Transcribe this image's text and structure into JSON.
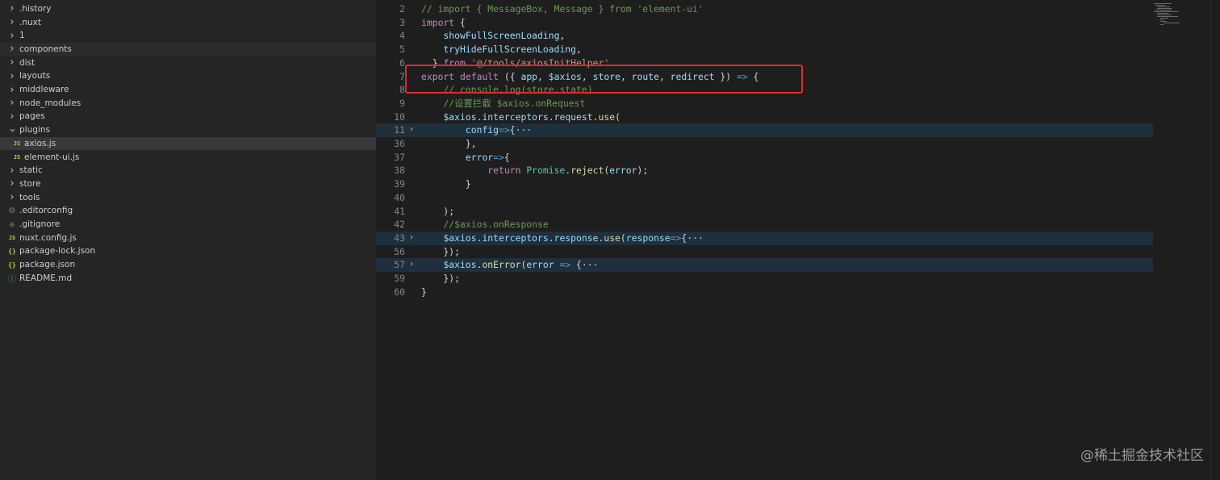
{
  "explorer": {
    "items": [
      {
        "label": ".history",
        "kind": "folder",
        "icon": "chevron-right-icon"
      },
      {
        "label": ".nuxt",
        "kind": "folder",
        "icon": "chevron-right-icon"
      },
      {
        "label": "1",
        "kind": "folder",
        "icon": "chevron-right-icon"
      },
      {
        "label": "components",
        "kind": "folder",
        "icon": "chevron-right-icon"
      },
      {
        "label": "dist",
        "kind": "folder",
        "icon": "chevron-right-icon"
      },
      {
        "label": "layouts",
        "kind": "folder",
        "icon": "chevron-right-icon"
      },
      {
        "label": "middleware",
        "kind": "folder",
        "icon": "chevron-right-icon"
      },
      {
        "label": "node_modules",
        "kind": "folder",
        "icon": "chevron-right-icon"
      },
      {
        "label": "pages",
        "kind": "folder",
        "icon": "chevron-right-icon"
      },
      {
        "label": "plugins",
        "kind": "folder-open",
        "icon": "chevron-down-icon"
      },
      {
        "label": "axios.js",
        "kind": "js",
        "icon": "js-file-icon",
        "badge": "JS",
        "nested": true,
        "selected": true
      },
      {
        "label": "element-ui.js",
        "kind": "js",
        "icon": "js-file-icon",
        "badge": "JS",
        "nested": true
      },
      {
        "label": "static",
        "kind": "folder",
        "icon": "chevron-right-icon"
      },
      {
        "label": "store",
        "kind": "folder",
        "icon": "chevron-right-icon"
      },
      {
        "label": "tools",
        "kind": "folder",
        "icon": "chevron-right-icon"
      },
      {
        "label": ".editorconfig",
        "kind": "config",
        "icon": "gear-icon"
      },
      {
        "label": ".gitignore",
        "kind": "git",
        "icon": "git-icon"
      },
      {
        "label": "nuxt.config.js",
        "kind": "js",
        "icon": "js-file-icon",
        "badge": "JS"
      },
      {
        "label": "package-lock.json",
        "kind": "json",
        "icon": "json-file-icon",
        "badge": "{}"
      },
      {
        "label": "package.json",
        "kind": "json",
        "icon": "json-file-icon",
        "badge": "{}"
      },
      {
        "label": "README.md",
        "kind": "md",
        "icon": "info-icon"
      }
    ]
  },
  "editor": {
    "lines": [
      {
        "n": "2",
        "fold": "",
        "bg": false,
        "tokens": [
          [
            "tok-comment",
            "// import { MessageBox, Message } from 'element-ui'"
          ]
        ]
      },
      {
        "n": "3",
        "fold": "",
        "bg": false,
        "tokens": [
          [
            "tok-kw",
            "import"
          ],
          [
            "tok-punc",
            " {"
          ]
        ]
      },
      {
        "n": "4",
        "fold": "",
        "bg": false,
        "tokens": [
          [
            "tok-punc",
            "    "
          ],
          [
            "tok-var",
            "showFullScreenLoading"
          ],
          [
            "tok-punc",
            ","
          ]
        ]
      },
      {
        "n": "5",
        "fold": "",
        "bg": false,
        "tokens": [
          [
            "tok-punc",
            "    "
          ],
          [
            "tok-var",
            "tryHideFullScreenLoading"
          ],
          [
            "tok-punc",
            ","
          ]
        ]
      },
      {
        "n": "6",
        "fold": "",
        "bg": false,
        "tokens": [
          [
            "tok-punc",
            "  } "
          ],
          [
            "tok-kw",
            "from"
          ],
          [
            "tok-punc",
            " "
          ],
          [
            "tok-str",
            "'@/tools/axiosInitHelper'"
          ]
        ]
      },
      {
        "n": "7",
        "fold": "",
        "bg": false,
        "tokens": [
          [
            "tok-kw",
            "export"
          ],
          [
            "tok-punc",
            " "
          ],
          [
            "tok-kw",
            "default"
          ],
          [
            "tok-punc",
            " ({ "
          ],
          [
            "tok-param",
            "app"
          ],
          [
            "tok-punc",
            ", "
          ],
          [
            "tok-param",
            "$axios"
          ],
          [
            "tok-punc",
            ", "
          ],
          [
            "tok-param",
            "store"
          ],
          [
            "tok-punc",
            ", "
          ],
          [
            "tok-param",
            "route"
          ],
          [
            "tok-punc",
            ", "
          ],
          [
            "tok-param",
            "redirect"
          ],
          [
            "tok-punc",
            " }) "
          ],
          [
            "tok-storage",
            "=>"
          ],
          [
            "tok-punc",
            " {"
          ]
        ]
      },
      {
        "n": "8",
        "fold": "",
        "bg": false,
        "tokens": [
          [
            "tok-punc",
            "    "
          ],
          [
            "tok-comment",
            "// console.log(store.state)"
          ]
        ]
      },
      {
        "n": "9",
        "fold": "",
        "bg": false,
        "tokens": [
          [
            "tok-punc",
            "    "
          ],
          [
            "tok-comment",
            "//设置拦截 $axios.onRequest"
          ]
        ]
      },
      {
        "n": "10",
        "fold": "",
        "bg": false,
        "tokens": [
          [
            "tok-punc",
            "    "
          ],
          [
            "tok-var",
            "$axios"
          ],
          [
            "tok-punc",
            "."
          ],
          [
            "tok-var",
            "interceptors"
          ],
          [
            "tok-punc",
            "."
          ],
          [
            "tok-var",
            "request"
          ],
          [
            "tok-punc",
            "."
          ],
          [
            "tok-fn",
            "use"
          ],
          [
            "tok-punc",
            "("
          ]
        ]
      },
      {
        "n": "11",
        "fold": "›",
        "bg": true,
        "tokens": [
          [
            "tok-punc",
            "        "
          ],
          [
            "tok-param",
            "config"
          ],
          [
            "tok-storage",
            "=>"
          ],
          [
            "tok-punc",
            "{"
          ],
          [
            "tok-ellipsis",
            "···"
          ]
        ]
      },
      {
        "n": "36",
        "fold": "",
        "bg": false,
        "tokens": [
          [
            "tok-punc",
            "        },"
          ]
        ]
      },
      {
        "n": "37",
        "fold": "",
        "bg": false,
        "tokens": [
          [
            "tok-punc",
            "        "
          ],
          [
            "tok-param",
            "error"
          ],
          [
            "tok-storage",
            "=>"
          ],
          [
            "tok-punc",
            "{"
          ]
        ]
      },
      {
        "n": "38",
        "fold": "",
        "bg": false,
        "tokens": [
          [
            "tok-punc",
            "            "
          ],
          [
            "tok-kw",
            "return"
          ],
          [
            "tok-punc",
            " "
          ],
          [
            "tok-cls",
            "Promise"
          ],
          [
            "tok-punc",
            "."
          ],
          [
            "tok-fn",
            "reject"
          ],
          [
            "tok-punc",
            "("
          ],
          [
            "tok-var",
            "error"
          ],
          [
            "tok-punc",
            ");"
          ]
        ]
      },
      {
        "n": "39",
        "fold": "",
        "bg": false,
        "tokens": [
          [
            "tok-punc",
            "        }"
          ]
        ]
      },
      {
        "n": "40",
        "fold": "",
        "bg": false,
        "tokens": []
      },
      {
        "n": "41",
        "fold": "",
        "bg": false,
        "tokens": [
          [
            "tok-punc",
            "    );"
          ]
        ]
      },
      {
        "n": "42",
        "fold": "",
        "bg": false,
        "tokens": [
          [
            "tok-punc",
            "    "
          ],
          [
            "tok-comment",
            "//$axios.onResponse"
          ]
        ]
      },
      {
        "n": "43",
        "fold": "›",
        "bg": true,
        "tokens": [
          [
            "tok-punc",
            "    "
          ],
          [
            "tok-var",
            "$axios"
          ],
          [
            "tok-punc",
            "."
          ],
          [
            "tok-var",
            "interceptors"
          ],
          [
            "tok-punc",
            "."
          ],
          [
            "tok-var",
            "response"
          ],
          [
            "tok-punc",
            "."
          ],
          [
            "tok-fn",
            "use"
          ],
          [
            "tok-punc",
            "("
          ],
          [
            "tok-param",
            "response"
          ],
          [
            "tok-storage",
            "=>"
          ],
          [
            "tok-punc",
            "{"
          ],
          [
            "tok-ellipsis",
            "···"
          ]
        ]
      },
      {
        "n": "56",
        "fold": "",
        "bg": false,
        "tokens": [
          [
            "tok-punc",
            "    });"
          ]
        ]
      },
      {
        "n": "57",
        "fold": "›",
        "bg": true,
        "tokens": [
          [
            "tok-punc",
            "    "
          ],
          [
            "tok-var",
            "$axios"
          ],
          [
            "tok-punc",
            "."
          ],
          [
            "tok-fn",
            "onError"
          ],
          [
            "tok-punc",
            "("
          ],
          [
            "tok-param",
            "error"
          ],
          [
            "tok-punc",
            " "
          ],
          [
            "tok-storage",
            "=>"
          ],
          [
            "tok-punc",
            " {"
          ],
          [
            "tok-ellipsis",
            "···"
          ]
        ]
      },
      {
        "n": "59",
        "fold": "",
        "bg": false,
        "tokens": [
          [
            "tok-punc",
            "    });"
          ]
        ]
      },
      {
        "n": "60",
        "fold": "",
        "bg": false,
        "tokens": [
          [
            "tok-punc",
            "}"
          ]
        ]
      }
    ]
  },
  "watermark": "@稀土掘金技术社区",
  "colors": {
    "highlight_box": "#e02a2a",
    "selected_row": "#37373d",
    "folded_line_bg": "#1f2f3b"
  }
}
